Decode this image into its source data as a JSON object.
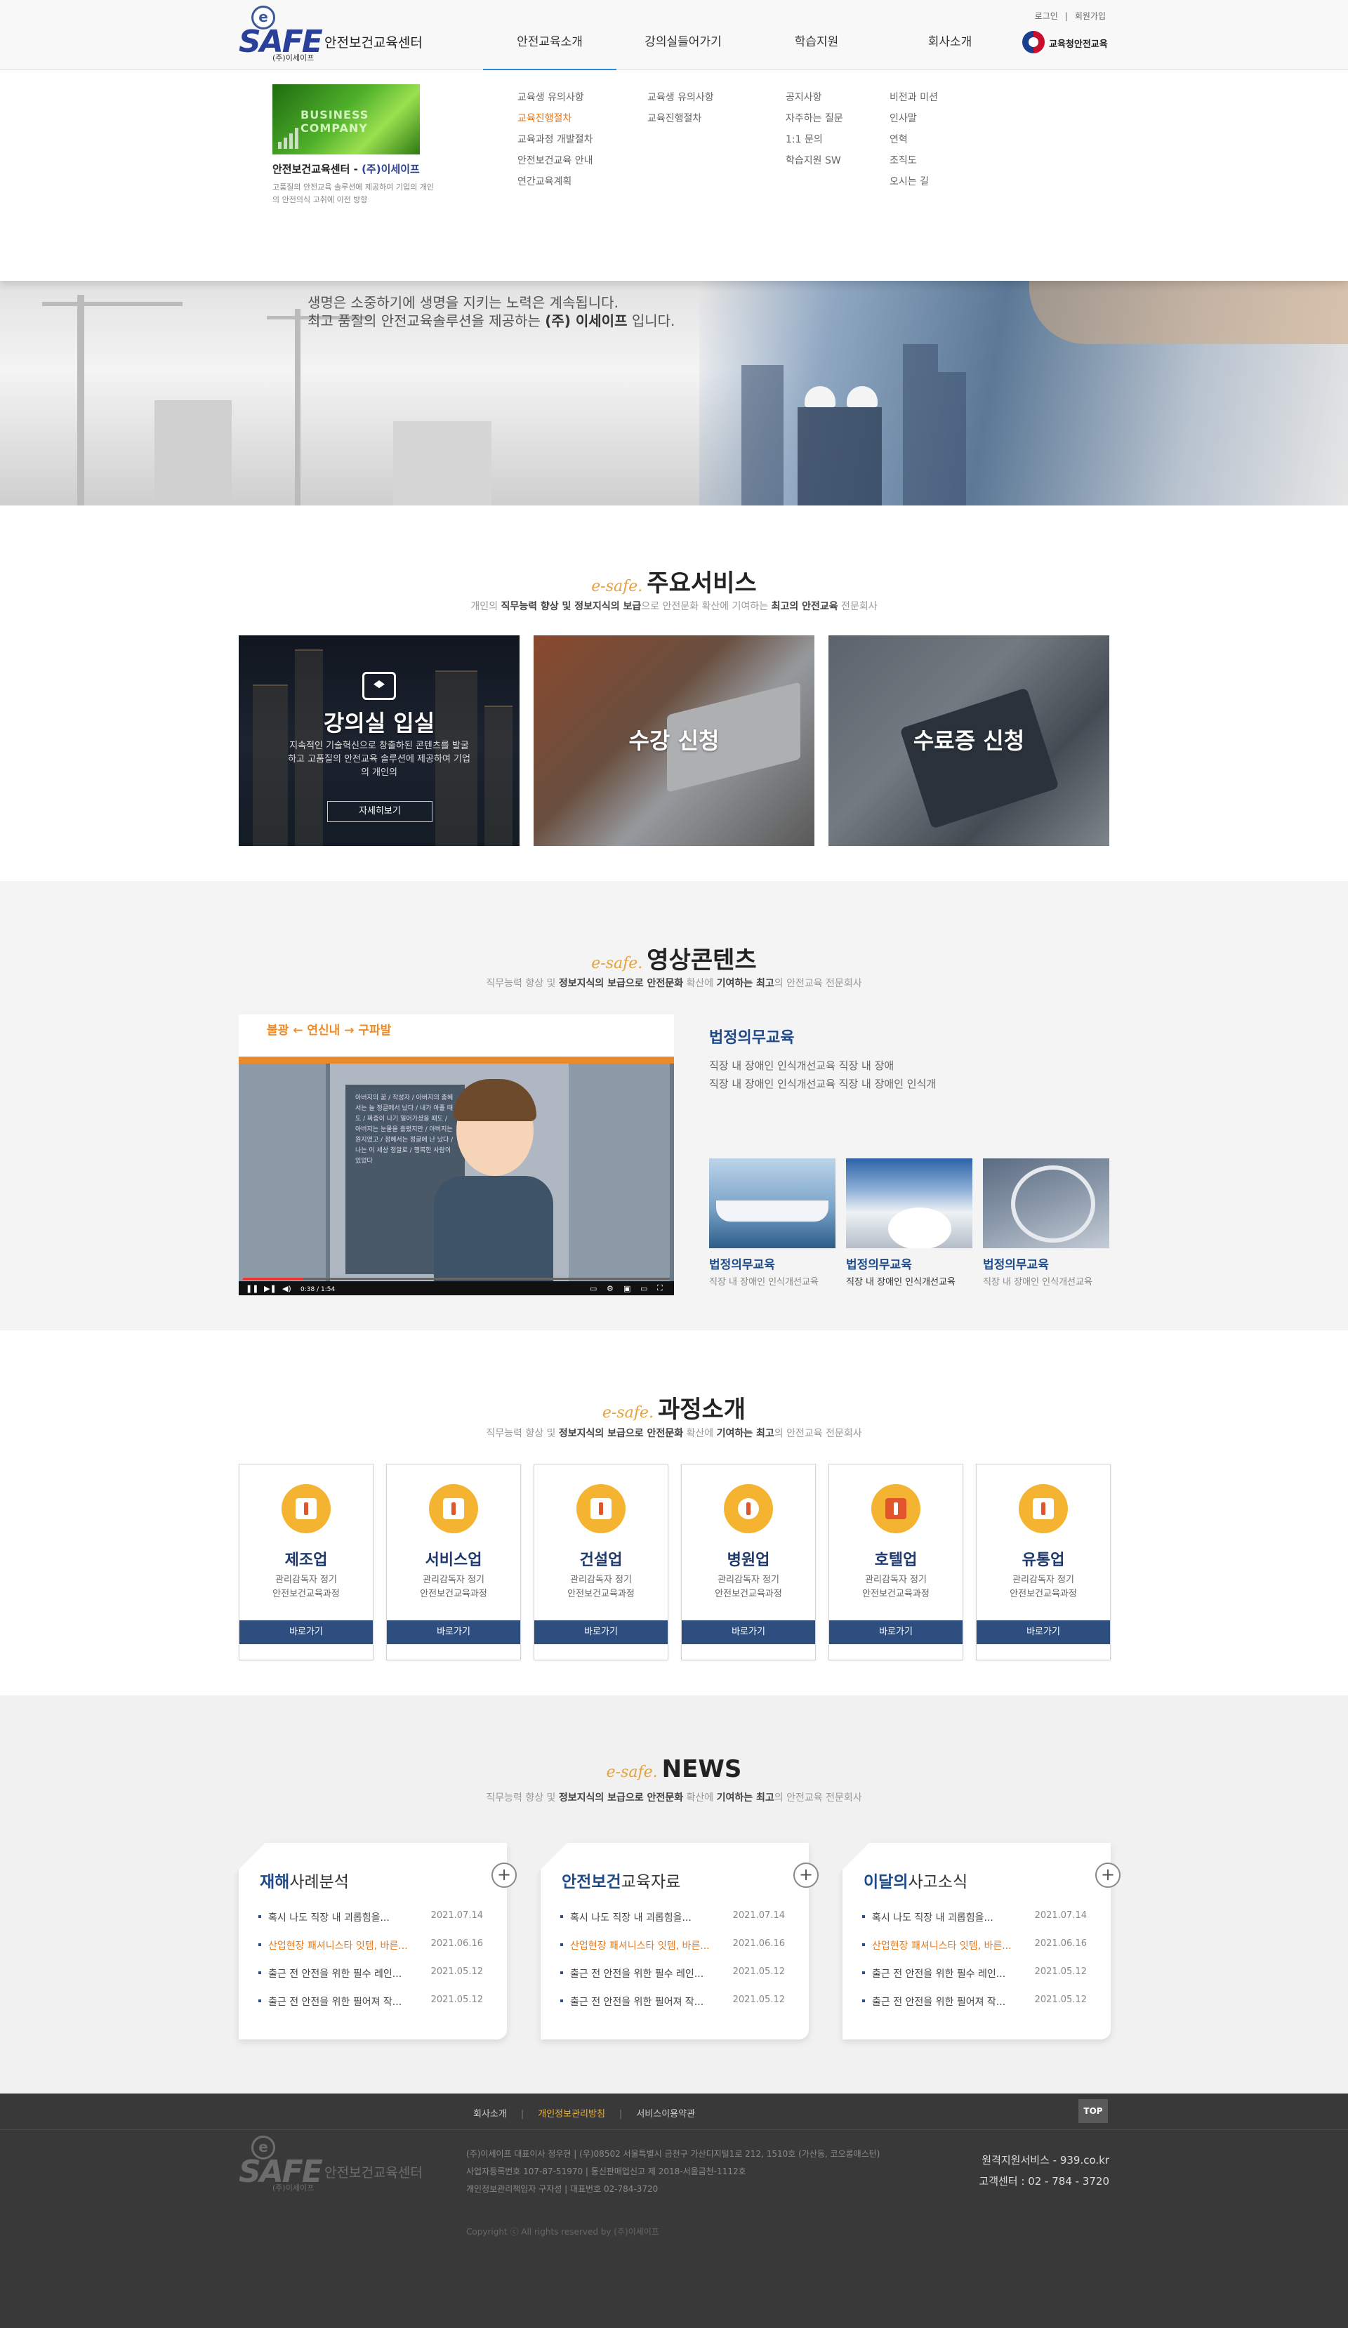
{
  "header": {
    "logo_mark": "e",
    "logo_word": "SAFE",
    "logo_sub": "(주)이세이프",
    "logo_center": "안전보건교육센터",
    "nav": [
      "안전교육소개",
      "강의실들어가기",
      "학습지원",
      "회사소개"
    ],
    "util": [
      "로그인",
      "|",
      "회원가입"
    ],
    "gov_label": "교육청안전교육"
  },
  "mega": {
    "image_text": "BUSINESS COMPANY",
    "title_prefix": "안전보건교육센터 - ",
    "title_brand": "(주)이세이프",
    "desc": "고품질의 안전교육 솔루션에 제공하여 기업의 개인의 안전의식 고취에 이전 방향",
    "col1": [
      "교육생 유의사항",
      "교육진행절차",
      "교육과정 개발절차",
      "안전보건교육 안내",
      "연간교육계획"
    ],
    "col2": [
      "교육생 유의사항",
      "교육진행절차"
    ],
    "col3": [
      "공지사항",
      "자주하는 질문",
      "1:1 문의",
      "학습지원 SW"
    ],
    "col4": [
      "비전과 미션",
      "인사말",
      "연혁",
      "조직도",
      "오시는 길"
    ]
  },
  "hero": {
    "line1": "생명은 소중하기에 생명을 지키는 노력은 계속됩니다.",
    "line2_prefix": "최고 품질의 안전교육솔루션을 제공하는 ",
    "line2_brand": "(주) 이세이프",
    "line2_suffix": " 입니다."
  },
  "services": {
    "es": "e-safe.",
    "title": "주요서비스",
    "sub_a": "개인의 ",
    "sub_b": "직무능력 향상 및 정보지식의 보급",
    "sub_c": "으로 안전문화 확산에 기여하는 ",
    "sub_d": "최고의 안전교육",
    "sub_e": " 전문회사",
    "card1_title": "강의실 입실",
    "card1_desc": "지속적인 기술혁신으로 창출하된 콘텐츠를 발굴하고 고품질의 안전교육 솔루션에 제공하여 기업의 개인의",
    "card1_btn": "자세히보기",
    "card2_title": "수강 신청",
    "card3_title": "수료증 신청"
  },
  "video": {
    "es": "e-safe.",
    "title": "영상콘텐츠",
    "sub_a": "직무능력 향상 및 ",
    "sub_b": "정보지식의 보급으로 안전문화",
    "sub_c": " 확산에 ",
    "sub_d": "기여하는 최고",
    "sub_e": "의 안전교육 전문회사",
    "player_signs": "불광 ← 연신내 → 구파발",
    "player_text": "아버지의 꿈 / 작성자 / 아버지의 충혜서는 늘 정글에서 났다 / 내가 아플 때도 / 짜증이 나기 일어가셨을 때도 / 아버지는 눈물을 흘렸지만 / 아버지는 원지였고 / 정혜서는 정글에 난 났다 / 나는 이 세상 정말로 / 행복한 사람이 있었다",
    "player_time": "0:38 / 1:54",
    "main_title": "법정의무교육",
    "main_desc1": "직장 내 장애인 인식개선교육 직장 내 장애",
    "main_desc2": "직장 내 장애인 인식개선교육 직장 내 장애인 인식개",
    "thumbs": [
      {
        "title": "법정의무교육",
        "desc": "직장 내 장애인 인식개선교육"
      },
      {
        "title": "법정의무교육",
        "desc": "직장 내 장애인 인식개선교육"
      },
      {
        "title": "법정의무교육",
        "desc": "직장 내 장애인 인식개선교육"
      }
    ]
  },
  "courses": {
    "es": "e-safe.",
    "title": "과정소개",
    "sub_a": "직무능력 향상 및 ",
    "sub_b": "정보지식의 보급으로 안전문화",
    "sub_c": " 확산에 ",
    "sub_d": "기여하는 최고",
    "sub_e": "의 안전교육 전문회사",
    "items": [
      {
        "name": "제조업",
        "desc1": "관리감독자 정기",
        "desc2": "안전보건교육과정",
        "btn": "바로가기"
      },
      {
        "name": "서비스업",
        "desc1": "관리감독자 정기",
        "desc2": "안전보건교육과정",
        "btn": "바로가기"
      },
      {
        "name": "건설업",
        "desc1": "관리감독자 정기",
        "desc2": "안전보건교육과정",
        "btn": "바로가기"
      },
      {
        "name": "병원업",
        "desc1": "관리감독자 정기",
        "desc2": "안전보건교육과정",
        "btn": "바로가기"
      },
      {
        "name": "호텔업",
        "desc1": "관리감독자 정기",
        "desc2": "안전보건교육과정",
        "btn": "바로가기"
      },
      {
        "name": "유통업",
        "desc1": "관리감독자 정기",
        "desc2": "안전보건교육과정",
        "btn": "바로가기"
      }
    ]
  },
  "news": {
    "es": "e-safe.",
    "title": "NEWS",
    "sub_a": "직무능력 향상 및 ",
    "sub_b": "정보지식의 보급으로 안전문화",
    "sub_c": " 확산에 ",
    "sub_d": "기여하는 최고",
    "sub_e": "의 안전교육 전문회사",
    "boxes": [
      {
        "title_b": "재해",
        "title_r": "사례분석",
        "items": [
          {
            "text": "혹시 나도 직장 내 괴롭힘을...",
            "date": "2021.07.14"
          },
          {
            "text": "산업현장 패셔니스타 잇템, 바른...",
            "date": "2021.06.16"
          },
          {
            "text": "출근 전 안전을 위한 필수 레인...",
            "date": "2021.05.12"
          },
          {
            "text": "출근 전 안전을 위한 필어져 작...",
            "date": "2021.05.12"
          }
        ]
      },
      {
        "title_b": "안전보건",
        "title_r": "교육자료",
        "items": [
          {
            "text": "혹시 나도 직장 내 괴롭힘을...",
            "date": "2021.07.14"
          },
          {
            "text": "산업현장 패셔니스타 잇템, 바른...",
            "date": "2021.06.16"
          },
          {
            "text": "출근 전 안전을 위한 필수 레인...",
            "date": "2021.05.12"
          },
          {
            "text": "출근 전 안전을 위한 필어져 작...",
            "date": "2021.05.12"
          }
        ]
      },
      {
        "title_b": "이달의",
        "title_r": "사고소식",
        "items": [
          {
            "text": "혹시 나도 직장 내 괴롭힘을...",
            "date": "2021.07.14"
          },
          {
            "text": "산업현장 패셔니스타 잇템, 바른...",
            "date": "2021.06.16"
          },
          {
            "text": "출근 전 안전을 위한 필수 레인...",
            "date": "2021.05.12"
          },
          {
            "text": "출근 전 안전을 위한 필어져 작...",
            "date": "2021.05.12"
          }
        ]
      }
    ]
  },
  "footer": {
    "links": [
      "회사소개",
      "개인정보관리방침",
      "서비스이용약관"
    ],
    "top": "TOP",
    "info1": "(주)이세이프  대표이사 정우현  |  (우)08502 서울특별시 금천구 가산디지털1로 212, 1510호 (가산동, 코오롱애스턴)",
    "info2": "사업자등록번호 107-87-51970  |  통신판매업신고 제 2018-서울금천-1112호",
    "info3": "개인정보관리책임자 구자성  |  대표번호 02-784-3720",
    "copyright": "Copyright ⓒ All rights reserved by (주)이세이프",
    "remote": "원격지원서비스 - 939.co.kr",
    "call": "고객센터 : 02 - 784 - 3720"
  }
}
